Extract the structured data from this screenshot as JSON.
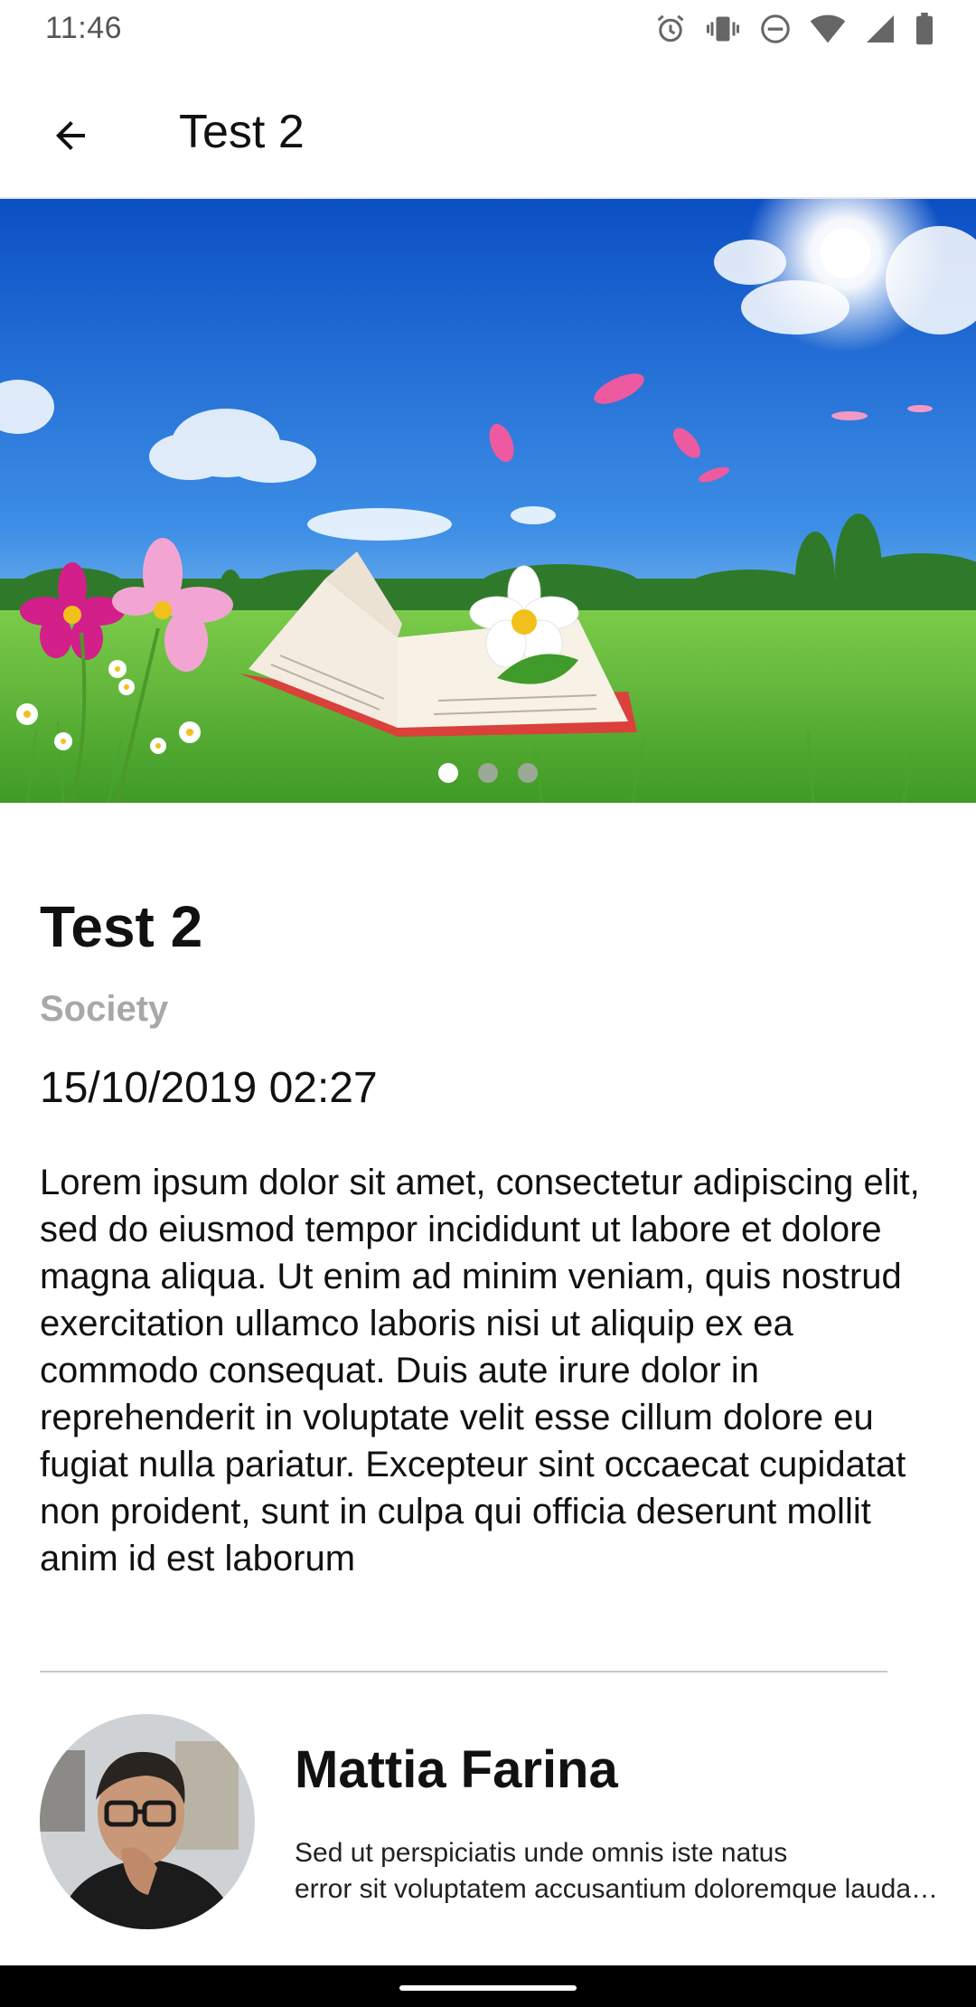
{
  "status_bar": {
    "time": "11:46",
    "icons": [
      "alarm-icon",
      "vibrate-icon",
      "do-not-disturb-icon",
      "wifi-icon",
      "signal-icon",
      "battery-icon"
    ]
  },
  "app_bar": {
    "back_icon": "arrow-back-icon",
    "title": "Test 2"
  },
  "carousel": {
    "slide_count": 3,
    "active_index": 0
  },
  "article": {
    "title": "Test 2",
    "category": "Society",
    "date": "15/10/2019 02:27",
    "body": "Lorem ipsum dolor sit amet, consectetur adipiscing elit, sed do eiusmod tempor incididunt ut labore et dolore magna aliqua. Ut enim ad minim veniam, quis nostrud exercitation ullamco laboris nisi ut aliquip ex ea commodo consequat. Duis aute irure dolor in reprehenderit in voluptate velit esse cillum dolore eu fugiat nulla pariatur. Excepteur sint occaecat cupidatat non proident, sunt in culpa qui officia deserunt mollit anim id est laborum"
  },
  "author": {
    "name": "Mattia Farina",
    "bio_line1": "Sed ut perspiciatis unde omnis iste natus",
    "bio_line2": "error sit voluptatem accusantium doloremque laudantium"
  },
  "colors": {
    "sky_top": "#1a5fd0",
    "grass": "#5fb83a",
    "category_gray": "#a8a8a8"
  }
}
